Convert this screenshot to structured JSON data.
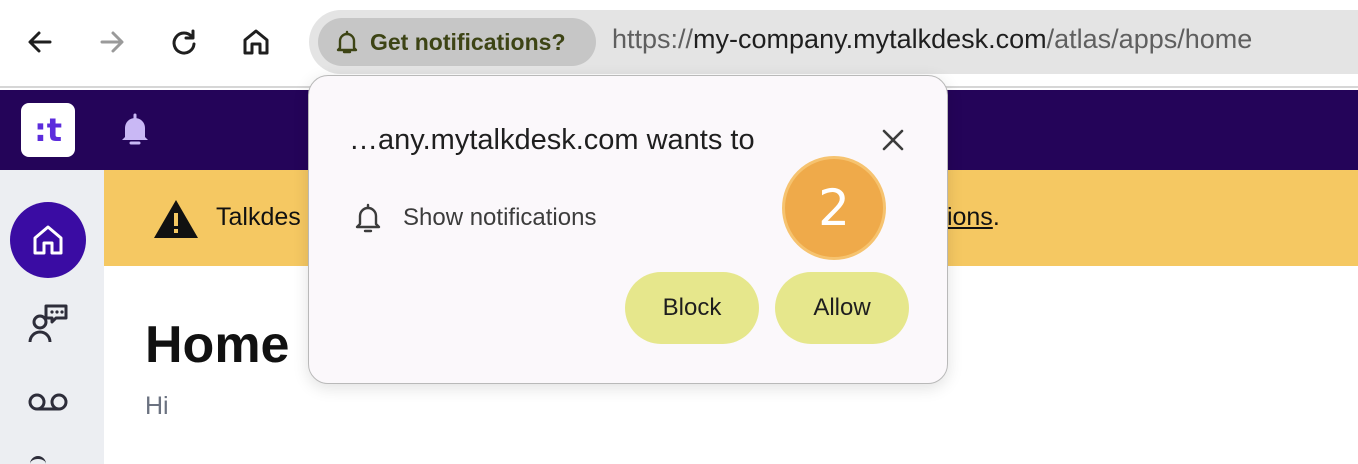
{
  "browser": {
    "notification_chip": "Get notifications?",
    "url_scheme": "https://",
    "url_host": "my-company.mytalkdesk.com",
    "url_path": "/atlas/apps/home",
    "icons": [
      "back-arrow-icon",
      "forward-arrow-icon",
      "reload-icon",
      "home-icon",
      "bell-icon"
    ]
  },
  "app": {
    "logo_text": ":t",
    "header_icon": "bell-icon"
  },
  "banner": {
    "text_visible_left": "Talkdes",
    "text_visible_right": "tions",
    "trailing_punct": ".",
    "icon": "warning-triangle-icon"
  },
  "page": {
    "title": "Home",
    "subtitle": "Hi"
  },
  "popup": {
    "title": "…any.mytalkdesk.com wants to",
    "permission": "Show notifications",
    "block_label": "Block",
    "allow_label": "Allow"
  },
  "annotation": {
    "step_number": "2"
  },
  "colors": {
    "header_bg": "#240459",
    "banner_bg": "#f5c862",
    "button_bg": "#e6e78c",
    "badge_bg": "#efaa4a",
    "sidebar_active": "#3a0ca3"
  }
}
